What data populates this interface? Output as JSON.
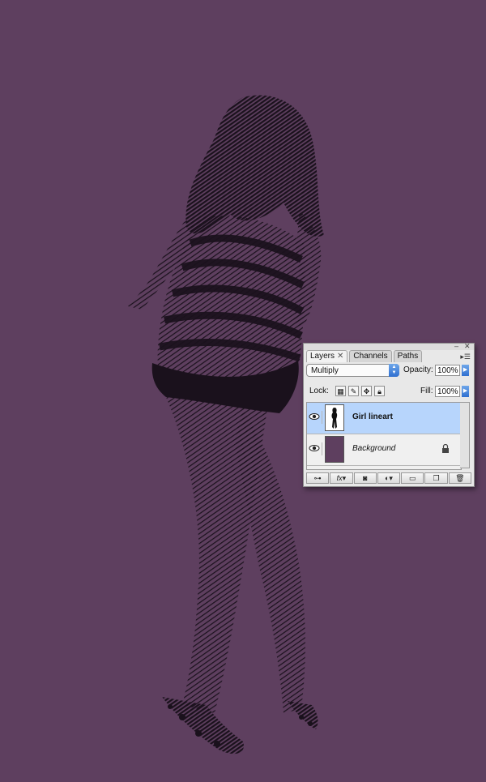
{
  "canvas": {
    "background_color": "#5e3f5f",
    "artwork": "halftone line-art figure of a girl in a striped top and spotted shoes",
    "ink_color": "#1a111c"
  },
  "panel": {
    "tabs": [
      {
        "label": "Layers",
        "active": true,
        "closable": true
      },
      {
        "label": "Channels",
        "active": false
      },
      {
        "label": "Paths",
        "active": false
      }
    ],
    "blend_mode": "Multiply",
    "opacity_label": "Opacity:",
    "opacity_value": "100%",
    "lock_label": "Lock:",
    "fill_label": "Fill:",
    "fill_value": "100%",
    "layers": [
      {
        "name": "Girl lineart",
        "selected": true,
        "visible": true,
        "locked": false,
        "thumbnail": "girl-silhouette"
      },
      {
        "name": "Background",
        "selected": false,
        "visible": true,
        "locked": true,
        "thumbnail": "solid-purple",
        "thumbnail_color": "#5e3f5f"
      }
    ],
    "bottom_buttons": [
      "link-layers-icon",
      "fx-icon",
      "add-mask-icon",
      "adjustment-layer-icon",
      "new-group-icon",
      "new-layer-icon",
      "delete-layer-icon"
    ],
    "fx_label": "fx",
    "selection_color": "#b7d5fc"
  }
}
